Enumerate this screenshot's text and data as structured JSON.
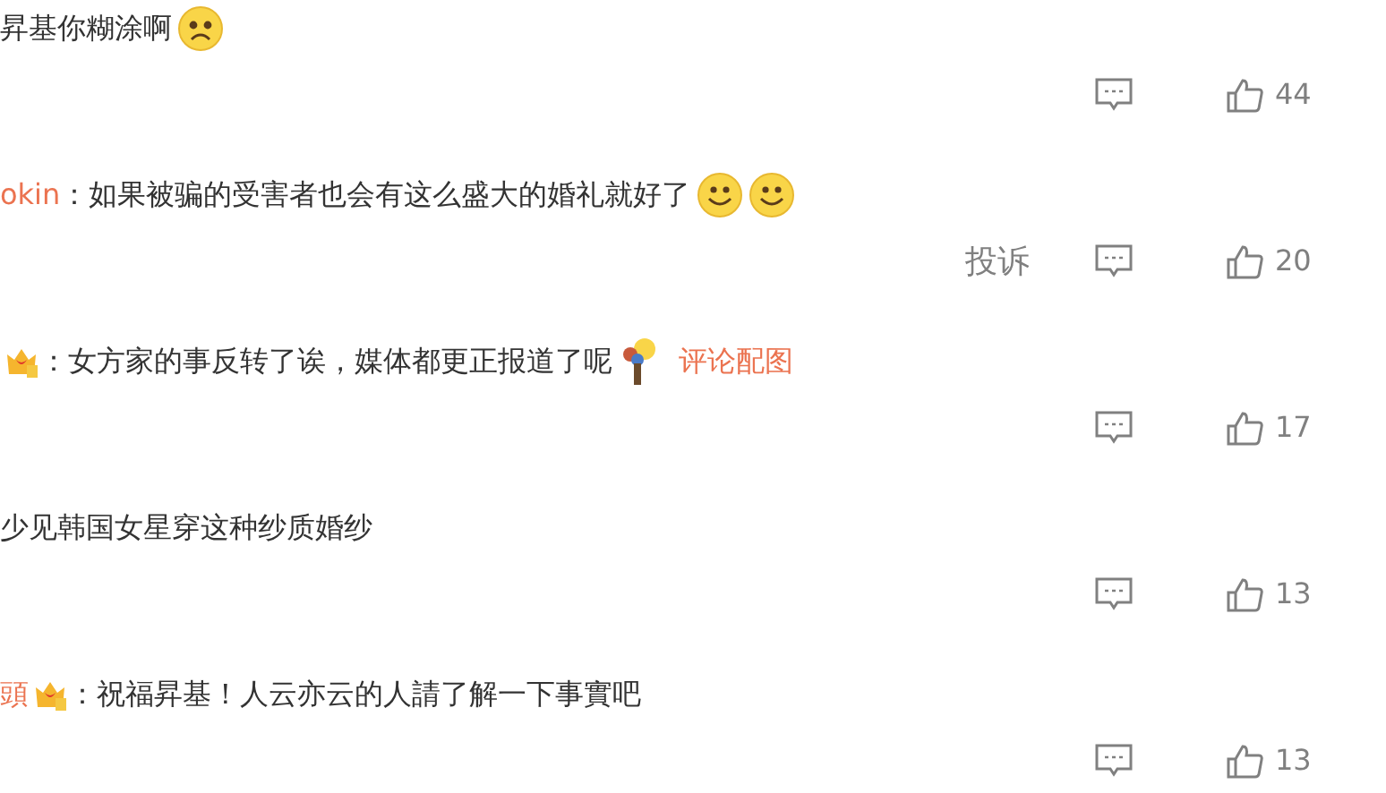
{
  "comments": [
    {
      "text": "昇基你糊涂啊",
      "emojis": [
        {
          "kind": "sad"
        }
      ],
      "actions": {
        "count": "44"
      }
    },
    {
      "user": "okin",
      "colon": "：",
      "text": "如果被骗的受害者也会有这么盛大的婚礼就好了",
      "emojis": [
        {
          "kind": "smile"
        },
        {
          "kind": "smile"
        }
      ],
      "actions": {
        "complaint": "投诉",
        "count": "20"
      }
    },
    {
      "badge": true,
      "colon": "：",
      "text": "女方家的事反转了诶，媒体都更正报道了呢",
      "emojis": [
        {
          "kind": "balloon"
        }
      ],
      "link": "评论配图",
      "actions": {
        "count": "17"
      }
    },
    {
      "text": "少见韩国女星穿这种纱质婚纱",
      "actions": {
        "count": "13"
      }
    },
    {
      "user": "頭",
      "badge": true,
      "colon": "：",
      "text": "祝福昇基！人云亦云的人請了解一下事實吧",
      "actions": {
        "count": "13"
      }
    }
  ]
}
